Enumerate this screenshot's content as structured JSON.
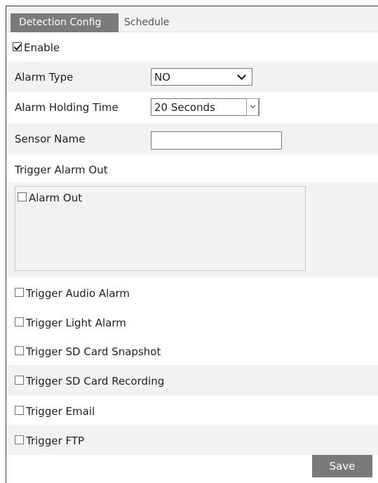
{
  "tabs": [
    {
      "label": "Detection Config",
      "active": true
    },
    {
      "label": "Schedule",
      "active": false
    }
  ],
  "enable": {
    "label": "Enable",
    "checked": true
  },
  "alarm_type": {
    "label": "Alarm Type",
    "value": "NO"
  },
  "holding_time": {
    "label": "Alarm Holding Time",
    "value": "20 Seconds"
  },
  "sensor_name": {
    "label": "Sensor Name",
    "value": ""
  },
  "trigger_alarm_out": {
    "label": "Trigger Alarm Out",
    "item_label": "Alarm Out",
    "checked": false
  },
  "triggers": [
    {
      "label": "Trigger Audio Alarm",
      "checked": false
    },
    {
      "label": "Trigger Light Alarm",
      "checked": false
    },
    {
      "label": "Trigger SD Card Snapshot",
      "checked": false
    },
    {
      "label": "Trigger SD Card Recording",
      "checked": false
    },
    {
      "label": "Trigger Email",
      "checked": false
    },
    {
      "label": "Trigger FTP",
      "checked": false
    }
  ],
  "save_label": "Save",
  "colors": {
    "tab_active_bg": "#7b7b7b",
    "row_shade": "#f2f2f2",
    "button_bg": "#7a7a7a"
  }
}
